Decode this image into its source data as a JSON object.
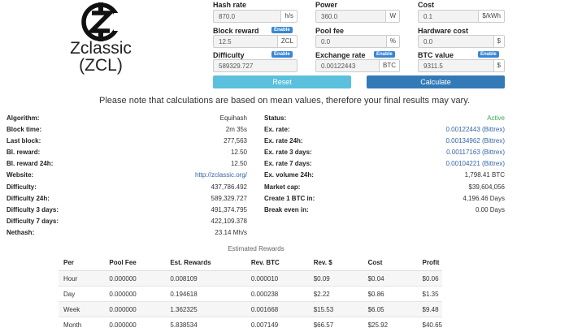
{
  "brand": {
    "name": "Zclassic",
    "ticker": "(ZCL)",
    "logo_icon": "zclassic-logo-icon"
  },
  "form": {
    "hash_rate": {
      "label": "Hash rate",
      "value": "870.0",
      "unit": "h/s"
    },
    "power": {
      "label": "Power",
      "value": "360.0",
      "unit": "W"
    },
    "cost": {
      "label": "Cost",
      "value": "0.1",
      "unit": "$/kWh"
    },
    "block_reward": {
      "label": "Block reward",
      "value": "12.5",
      "unit": "ZCL",
      "badge": "Enable"
    },
    "pool_fee": {
      "label": "Pool fee",
      "value": "0.0",
      "unit": "%"
    },
    "hardware_cost": {
      "label": "Hardware cost",
      "value": "0.0",
      "unit": "$"
    },
    "difficulty": {
      "label": "Difficulty",
      "value": "589329.727",
      "badge": "Enable"
    },
    "exchange_rate": {
      "label": "Exchange rate",
      "value": "0.00122443",
      "unit": "BTC",
      "badge": "Enable"
    },
    "btc_value": {
      "label": "BTC value",
      "value": "9311.5",
      "unit": "$",
      "badge": "Enable"
    },
    "reset_label": "Reset",
    "calculate_label": "Calculate"
  },
  "note": "Please note that calculations are based on mean values, therefore your final results may vary.",
  "left_stats": [
    {
      "key": "Algorithm:",
      "value": "Equihash"
    },
    {
      "key": "Block time:",
      "value": "2m 35s"
    },
    {
      "key": "Last block:",
      "value": "277,563"
    },
    {
      "key": "Bl. reward:",
      "value": "12.50"
    },
    {
      "key": "Bl. reward 24h:",
      "value": "12.50"
    },
    {
      "key": "Website:",
      "value": "http://zclassic.org/"
    },
    {
      "key": "Difficulty:",
      "value": "437,786.492"
    },
    {
      "key": "Difficulty 24h:",
      "value": "589,329.727"
    },
    {
      "key": "Difficulty 3 days:",
      "value": "491,374.795"
    },
    {
      "key": "Difficulty 7 days:",
      "value": "422,109.378"
    },
    {
      "key": "Nethash:",
      "value": "23.14 Mh/s"
    }
  ],
  "right_stats": [
    {
      "key": "Status:",
      "value": "Active"
    },
    {
      "key": "Ex. rate:",
      "value": "0.00122443 (Bittrex)"
    },
    {
      "key": "Ex. rate 24h:",
      "value": "0.00134962 (Bittrex)"
    },
    {
      "key": "Ex. rate 3 days:",
      "value": "0.00117163 (Bittrex)"
    },
    {
      "key": "Ex. rate 7 days:",
      "value": "0.00104221 (Bittrex)"
    },
    {
      "key": "Ex. volume 24h:",
      "value": "1,798.41 BTC"
    },
    {
      "key": "Market cap:",
      "value": "$39,604,056"
    },
    {
      "key": "Create 1 BTC in:",
      "value": "4,196.46 Days"
    },
    {
      "key": "Break even in:",
      "value": "0.00 Days"
    }
  ],
  "rewards": {
    "title": "Estimated Rewards",
    "headers": [
      "Per",
      "Pool Fee",
      "Est. Rewards",
      "Rev. BTC",
      "Rev. $",
      "Cost",
      "Profit"
    ],
    "rows": [
      [
        "Hour",
        "0.000000",
        "0.008109",
        "0.000010",
        "$0.09",
        "$0.04",
        "$0.06"
      ],
      [
        "Day",
        "0.000000",
        "0.194618",
        "0.000238",
        "$2.22",
        "$0.86",
        "$1.35"
      ],
      [
        "Week",
        "0.000000",
        "1.362325",
        "0.001668",
        "$15.53",
        "$6.05",
        "$9.48"
      ],
      [
        "Month",
        "0.000000",
        "5.838534",
        "0.007149",
        "$66.57",
        "$25.92",
        "$40.65"
      ]
    ]
  },
  "colors": {
    "reset": "#5bc0de",
    "calculate": "#337ab7",
    "badge": "#3a86d4",
    "link": "#3565a6",
    "active": "#3aa65a"
  }
}
